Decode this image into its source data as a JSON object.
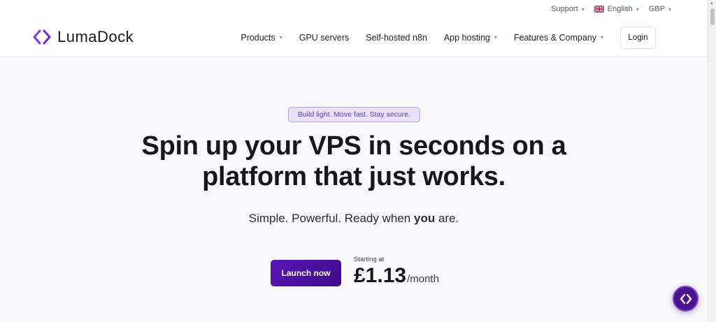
{
  "utility": {
    "support": "Support",
    "language": "English",
    "currency": "GBP"
  },
  "brand": {
    "name": "LumaDock"
  },
  "nav": {
    "items": [
      {
        "label": "Products",
        "dropdown": true
      },
      {
        "label": "GPU servers",
        "dropdown": false
      },
      {
        "label": "Self-hosted n8n",
        "dropdown": false
      },
      {
        "label": "App hosting",
        "dropdown": true
      },
      {
        "label": "Features & Company",
        "dropdown": true
      }
    ],
    "login": "Login"
  },
  "hero": {
    "pill": "Build light. Move fast. Stay secure.",
    "title_line1": "Spin up your VPS in seconds on a",
    "title_line2": "platform that just works.",
    "sub_before": "Simple. Powerful. Ready when ",
    "sub_bold": "you",
    "sub_after": " are.",
    "cta": "Launch now",
    "price_label": "Starting at",
    "price": "£1.13",
    "price_unit": "/month"
  },
  "colors": {
    "accent": "#5a16b8",
    "pill_bg": "#e8e0fb",
    "hero_bg": "#f8f7f9"
  },
  "icons": {
    "brand": "lumadock-logo-icon",
    "flag": "uk-flag-icon",
    "chat": "chat-launcher-icon"
  }
}
